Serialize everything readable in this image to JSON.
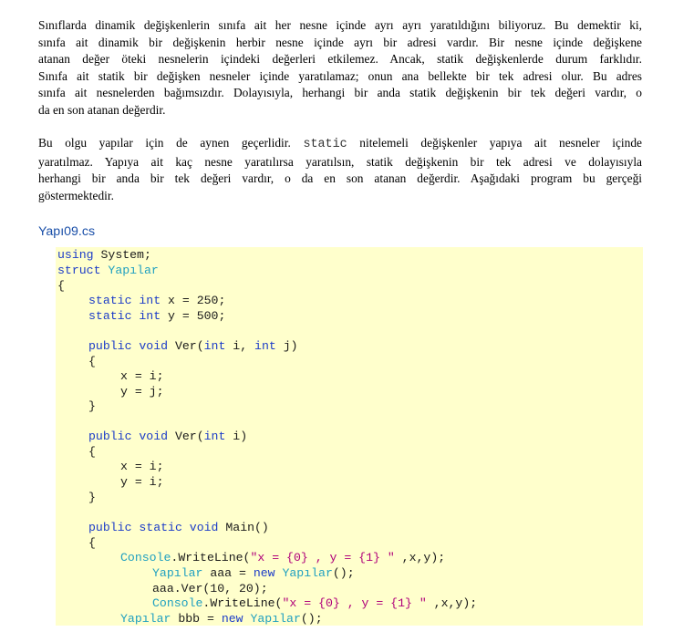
{
  "paragraph1": {
    "lines": [
      "Sınıflarda dinamik değişkenlerin sınıfa ait her nesne içinde ayrı ayrı yaratıldığını biliyoruz. Bu demektir ki,",
      "sınıfa ait dinamik bir değişkenin herbir nesne içinde ayrı bir adresi vardır.  Bir nesne içinde değişkene",
      "atanan değer öteki nesnelerin içindeki değerleri etkilemez. Ancak, statik değişkenlerde durum farklıdır.",
      "Sınıfa ait statik bir değişken nesneler içinde yaratılamaz; onun ana bellekte bir tek adresi olur. Bu adres",
      "sınıfa ait nesnelerden bağımsızdır. Dolayısıyla, herhangi bir anda statik değişkenin bir tek değeri vardır, o",
      "da en son atanan değerdir."
    ]
  },
  "paragraph2": {
    "line1_before": "Bu olgu yapılar için de aynen geçerlidir.",
    "line1_keyword": "static",
    "line1_after": "nitelemeli değişkenler yapıya ait nesneler içinde",
    "lines": [
      "yaratılmaz. Yapıya ait kaç nesne yaratılırsa yaratılsın, statik değişkenin bir tek adresi ve dolayısıyla",
      "herhangi bir anda bir tek değeri vardır, o da en son atanan değerdir. Aşağıdaki program bu gerçeği",
      "göstermektedir."
    ]
  },
  "file_title": "Yapı09.cs",
  "code": {
    "l01_k": "using",
    "l01_n": " System;",
    "l02_k": "struct",
    "l02_t": "Yapılar",
    "l03_n": "{",
    "l04_k": "static int",
    "l04_n": " x = 250;",
    "l05_k": "static int",
    "l05_n": " y = 500;",
    "l06_k": "public void",
    "l06_n1": " Ver(",
    "l06_k2": "int",
    "l06_n2": " i, ",
    "l06_k3": "int",
    "l06_n3": " j)",
    "l07_n": "{",
    "l08_n": "x = i;",
    "l09_n": "y = j;",
    "l10_n": "}",
    "l11_k": "public void",
    "l11_n1": " Ver(",
    "l11_k2": "int",
    "l11_n2": " i)",
    "l12_n": "{",
    "l13_n": "x = i;",
    "l14_n": "y = i;",
    "l15_n": "}",
    "l16_k": "public static void",
    "l16_n": " Main()",
    "l17_n": "{",
    "l18_t": "Console",
    "l18_n1": ".WriteLine(",
    "l18_s": "\"x = {0} , y = {1} \"",
    "l18_n2": " ,x,y);",
    "l19_t": "Yapılar",
    "l19_n": " aaa = ",
    "l19_k": "new",
    "l19_t2": "Yapılar",
    "l19_n2": "();",
    "l20_n": "aaa.Ver(10, 20);",
    "l21_t": "Console",
    "l21_n1": ".WriteLine(",
    "l21_s": "\"x = {0} , y = {1} \"",
    "l21_n2": " ,x,y);",
    "l22_t": "Yapılar",
    "l22_n": " bbb = ",
    "l22_k": "new",
    "l22_t2": "Yapılar",
    "l22_n2": "();"
  },
  "colors": {
    "keyword": "#1c3cc8",
    "type": "#20a0c0",
    "string": "#b0007a",
    "code_background": "#ffffcc",
    "file_title": "#1a4fa8"
  }
}
